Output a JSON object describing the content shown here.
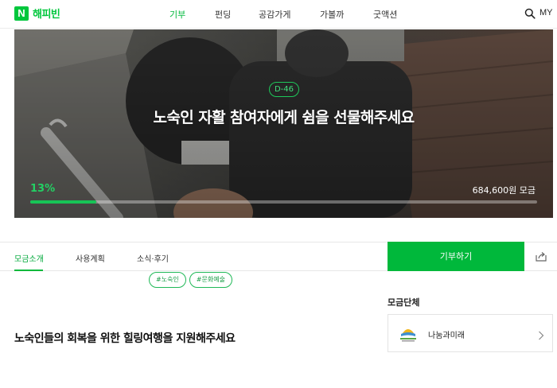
{
  "header": {
    "logo_mark": "N",
    "logo_text": "해피빈",
    "nav": [
      {
        "label": "기부",
        "active": true
      },
      {
        "label": "펀딩",
        "active": false
      },
      {
        "label": "공감가게",
        "active": false
      },
      {
        "label": "가볼까",
        "active": false
      },
      {
        "label": "굿액션",
        "active": false
      }
    ],
    "search_icon": "search-icon",
    "my_label": "MY"
  },
  "campaign": {
    "dday": "D-46",
    "title": "노숙인 자활 참여자에게 쉼을 선물해주세요",
    "percent_label": "13%",
    "progress": 0.13,
    "amount": "684,600원 모금"
  },
  "tabs": [
    {
      "label": "모금소개",
      "active": true
    },
    {
      "label": "사용계획",
      "active": false
    },
    {
      "label": "소식·후기",
      "active": false
    }
  ],
  "donate_label": "기부하기",
  "share_icon": "share-icon",
  "tags": [
    "#노숙인",
    "#문화예술"
  ],
  "content_title": "노숙인들의 회복을 위한 힐링여행을 지원해주세요",
  "organization": {
    "heading": "모금단체",
    "name": "나눔과미래",
    "logo_icon": "organization-logo",
    "chevron_icon": "chevron-right-icon"
  },
  "colors": {
    "brand_green": "#00c73c",
    "button_green": "#00b83b"
  }
}
